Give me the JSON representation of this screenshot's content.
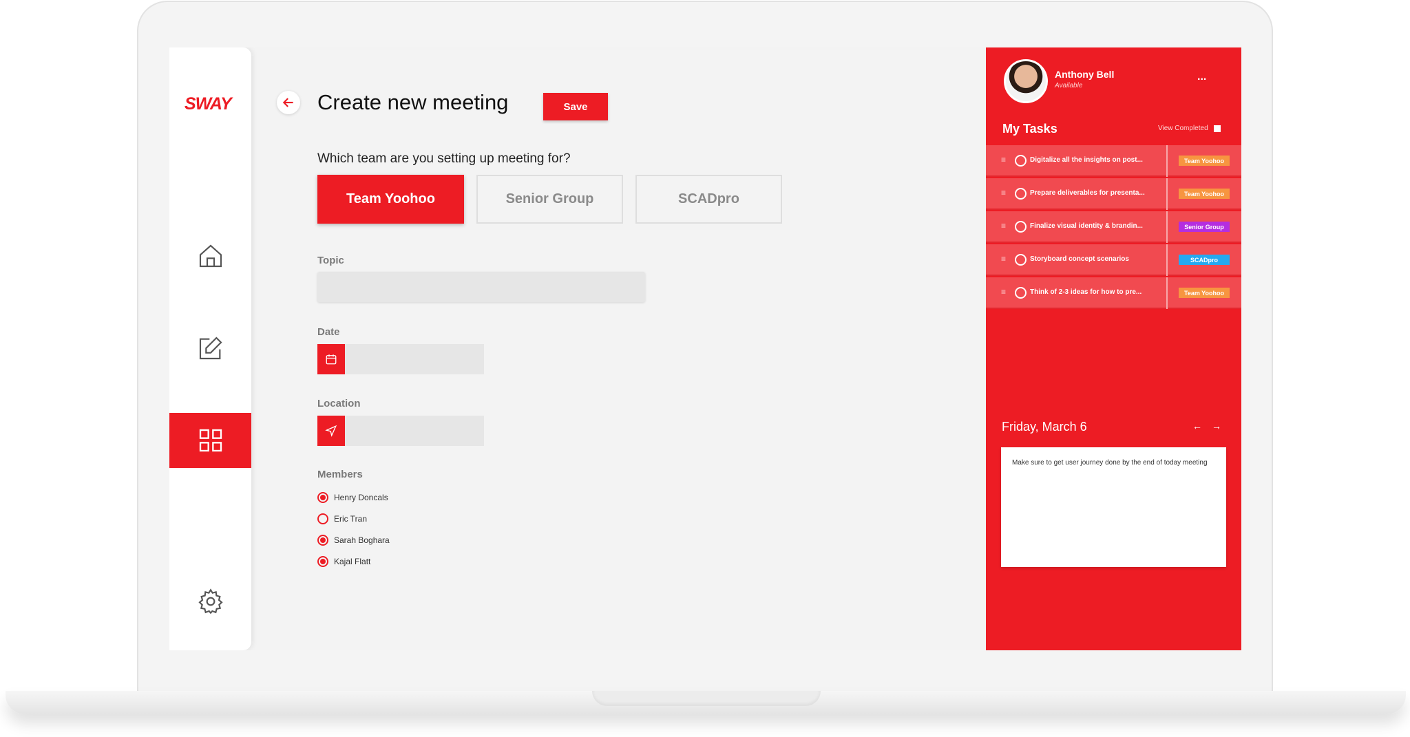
{
  "app": {
    "logo": "SWAY"
  },
  "sidebar": {
    "items": [
      {
        "name": "home",
        "icon": "home-icon"
      },
      {
        "name": "edit",
        "icon": "edit-icon"
      },
      {
        "name": "dashboard",
        "icon": "grid-icon",
        "active": true
      },
      {
        "name": "settings",
        "icon": "gear-icon"
      }
    ]
  },
  "header": {
    "title": "Create new meeting",
    "save_label": "Save",
    "back_icon": "arrow-left-icon"
  },
  "form": {
    "question": "Which team are you setting up meeting for?",
    "teams": [
      {
        "label": "Team Yoohoo",
        "selected": true
      },
      {
        "label": "Senior Group",
        "selected": false
      },
      {
        "label": "SCADpro",
        "selected": false
      }
    ],
    "topic_label": "Topic",
    "topic_value": "",
    "date_label": "Date",
    "date_value": "",
    "date_icon": "calendar-icon",
    "location_label": "Location",
    "location_value": "",
    "location_icon": "navigation-icon",
    "members_label": "Members",
    "members": [
      {
        "name": "Henry Doncals",
        "checked": true
      },
      {
        "name": "Eric Tran",
        "checked": false
      },
      {
        "name": "Sarah Boghara",
        "checked": true
      },
      {
        "name": "Kajal Flatt",
        "checked": true
      }
    ]
  },
  "panel": {
    "user": {
      "name": "Anthony Bell",
      "status": "Available"
    },
    "menu_label": "...",
    "tasks_title": "My Tasks",
    "view_completed": "View Completed",
    "tasks": [
      {
        "text": "Digitalize all the insights on post...",
        "tag": "Team Yoohoo",
        "tag_color": "#f79540"
      },
      {
        "text": "Prepare deliverables for presenta...",
        "tag": "Team Yoohoo",
        "tag_color": "#f79540"
      },
      {
        "text": "Finalize visual identity & brandin...",
        "tag": "Senior Group",
        "tag_color": "#b42ee0"
      },
      {
        "text": "Storyboard concept scenarios",
        "tag": "SCADpro",
        "tag_color": "#25a9f0"
      },
      {
        "text": "Think of 2-3 ideas for how to pre...",
        "tag": "Team Yoohoo",
        "tag_color": "#f79540"
      }
    ],
    "date": "Friday, March 6",
    "prev_icon": "arrow-left-icon",
    "next_icon": "arrow-right-icon",
    "note": "Make sure to get user journey done by the end of today meeting"
  },
  "colors": {
    "accent": "#ed1c24",
    "panel_row": "#f14a50",
    "background": "#f3f3f3"
  }
}
